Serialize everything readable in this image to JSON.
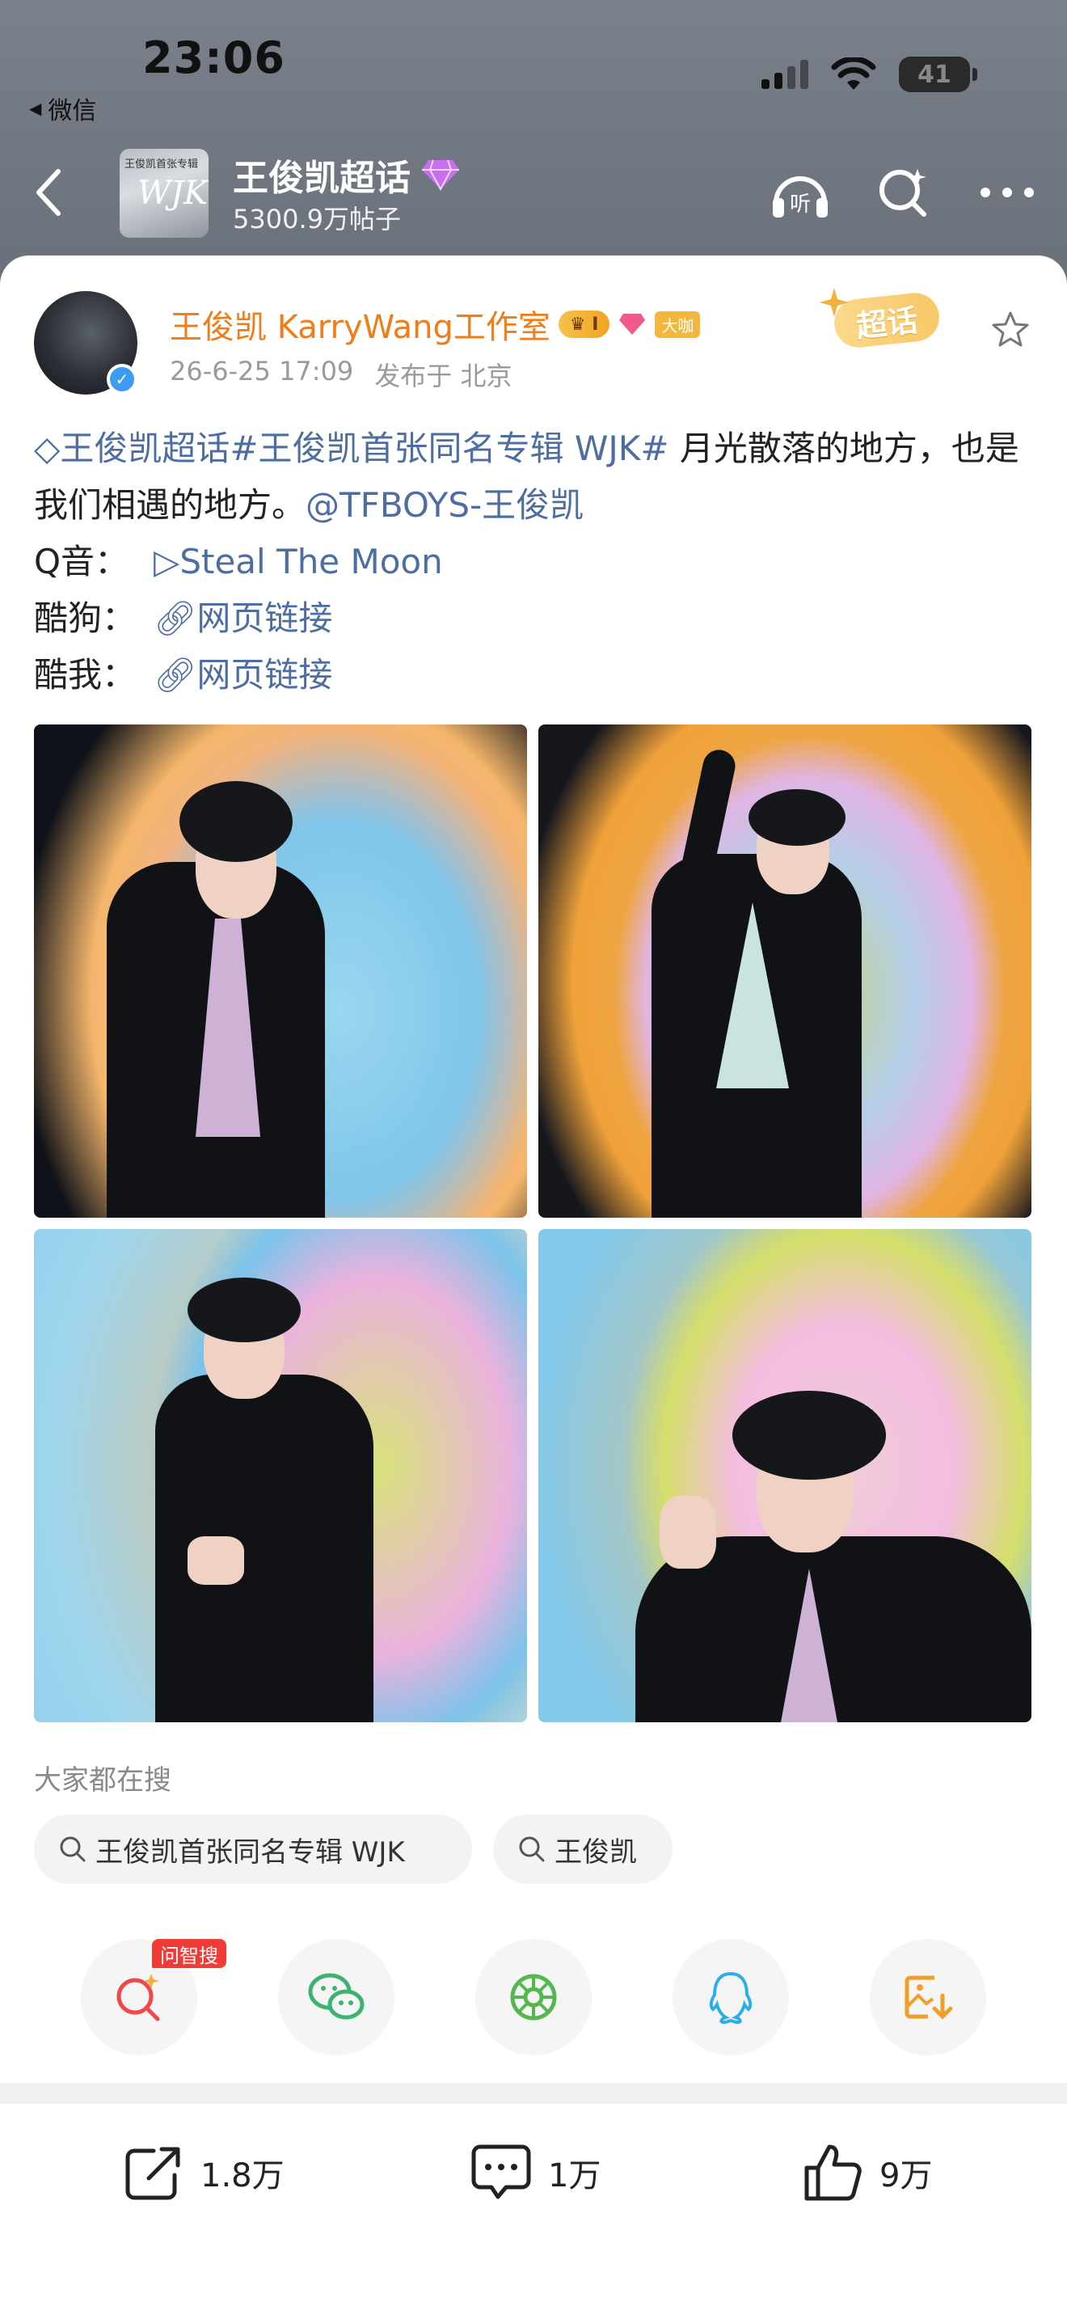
{
  "status_bar": {
    "time": "23:06",
    "back_app": "微信",
    "battery": "41"
  },
  "topic": {
    "title": "王俊凯超话",
    "posts_count": "5300.9万帖子",
    "cover_text": {
      "top": "王俊凯首张专辑",
      "middle": "WJK"
    }
  },
  "post": {
    "author": "王俊凯 KarryWang工作室",
    "crown_badge": "I",
    "big_badge": "大咖",
    "chaohua_tag": "超话",
    "time": "26-6-25 17:09",
    "location": "发布于 北京",
    "text": {
      "tag1": "王俊凯超话",
      "tag2": "#王俊凯首张同名专辑 WJK#",
      "sentence_a": " 月光散落的地方，也是我们相遇的地方。",
      "mention": "@TFBOYS-王俊凯",
      "q_label": "Q音：",
      "q_link": "Steal The Moon",
      "kugou_label": "酷狗：",
      "kugou_link": "网页链接",
      "kuwo_label": "酷我：",
      "kuwo_link": "网页链接"
    }
  },
  "search": {
    "label": "大家都在搜",
    "chips": [
      "王俊凯首张同名专辑 WJK",
      "王俊凯"
    ]
  },
  "share": {
    "ask_badge": "问智搜",
    "icons": [
      "ask-search-icon",
      "wechat-icon",
      "moments-icon",
      "qq-icon",
      "save-image-icon"
    ]
  },
  "actions": {
    "reposts": "1.8万",
    "comments": "1万",
    "likes": "9万"
  },
  "colors": {
    "author": "#f07d18",
    "link": "#4e6ea2",
    "header_bg": "#737983"
  }
}
